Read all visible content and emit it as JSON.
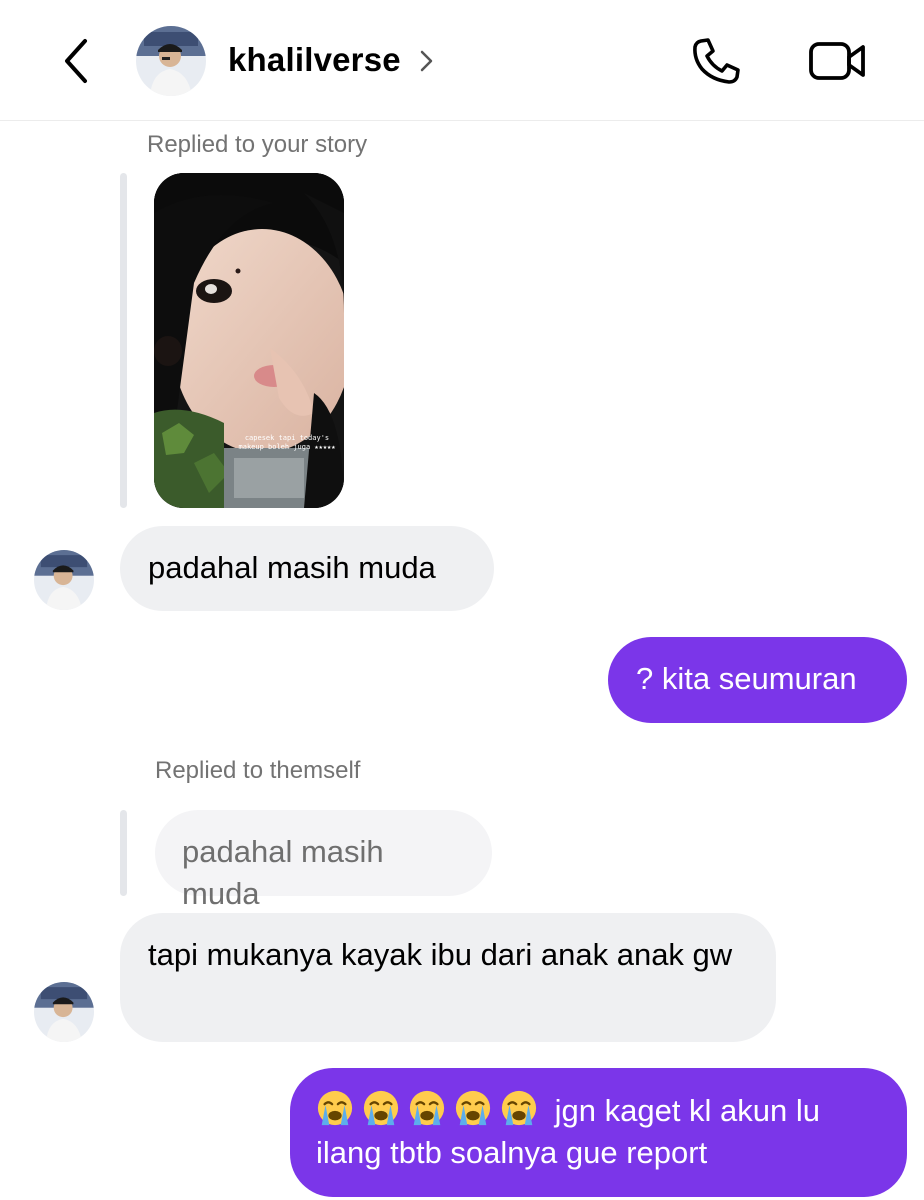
{
  "header": {
    "username": "khalilverse"
  },
  "thread": {
    "story_reply_label": "Replied to your story",
    "story_caption": "capesek tapi today's makeup boleh juga ★★★★★",
    "message_1": "padahal masih muda",
    "message_2": "? kita seumuran",
    "reply_label": "Replied to themself",
    "quoted_text": "padahal masih muda",
    "message_3": "tapi mukanya kayak ibu dari anak anak gw",
    "message_4_emoji": "😭😭😭😭😭",
    "message_4_text": "jgn kaget kl akun lu ilang tbtb soalnya gue report"
  },
  "colors": {
    "outgoing_bubble": "#7b36e9",
    "incoming_bubble": "#eff0f2",
    "meta_text": "#737373"
  },
  "icons": {
    "back": "chevron-left-icon",
    "profile_chevron": "chevron-right-icon",
    "call": "phone-icon",
    "video": "video-camera-icon",
    "emoji": "loudly-crying-face"
  }
}
